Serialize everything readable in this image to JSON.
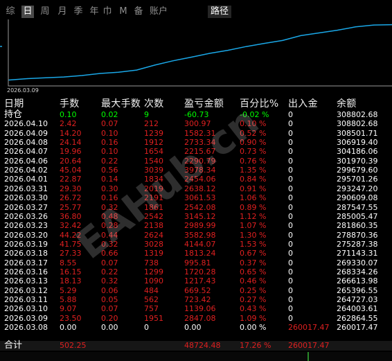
{
  "colors": {
    "background": "#000000",
    "text_red": "#e02020",
    "text_white": "#ffffff",
    "text_green": "#00ff00",
    "chart_line": "#1aa8e8",
    "active_tab": "#4a4a4a"
  },
  "tabs": [
    {
      "label": "综"
    },
    {
      "label": "日"
    },
    {
      "label": "周"
    },
    {
      "label": "月"
    },
    {
      "label": "季"
    },
    {
      "label": "年"
    },
    {
      "label": "巾"
    },
    {
      "label": "M"
    },
    {
      "label": "备"
    },
    {
      "label": "账户"
    },
    {
      "label": "路径"
    }
  ],
  "chart": {
    "start_date_label": "2026.03.09"
  },
  "chart_data": {
    "type": "line",
    "series": [
      {
        "values": [
          262864.55,
          264003.61,
          264727.03,
          265396.55,
          266613.98,
          268334.26,
          269330.07,
          271143.31,
          275287.38,
          278870.36,
          281860.35,
          285005.47,
          287547.55,
          290609.08,
          293247.2,
          295701.26,
          299679.6,
          301970.39,
          304186.06,
          306919.4,
          308501.71,
          308802.68
        ]
      }
    ]
  },
  "columns": [
    "日期",
    "手数",
    "最大手数",
    "次数",
    "盈亏金额",
    "百分比%",
    "出入金",
    "余额"
  ],
  "rows": [
    {
      "date": "持仓",
      "lots": "0.10",
      "max_lots": "0.02",
      "count": "9",
      "pnl": "-60.73",
      "pct": "-0.02 %",
      "io": "0",
      "balance": "308802.68",
      "style": "hold"
    },
    {
      "date": "2026.04.10",
      "lots": "2.42",
      "max_lots": "0.07",
      "count": "212",
      "pnl": "300.97",
      "pct": "0.10 %",
      "io": "0",
      "balance": "308802.68",
      "style": "red"
    },
    {
      "date": "2026.04.09",
      "lots": "14.20",
      "max_lots": "0.10",
      "count": "1239",
      "pnl": "1582.31",
      "pct": "0.52 %",
      "io": "0",
      "balance": "308501.71",
      "style": "red"
    },
    {
      "date": "2026.04.08",
      "lots": "24.14",
      "max_lots": "0.16",
      "count": "1912",
      "pnl": "2733.34",
      "pct": "0.90 %",
      "io": "0",
      "balance": "306919.40",
      "style": "red"
    },
    {
      "date": "2026.04.07",
      "lots": "19.96",
      "max_lots": "0.10",
      "count": "1654",
      "pnl": "2215.67",
      "pct": "0.73 %",
      "io": "0",
      "balance": "304186.06",
      "style": "red"
    },
    {
      "date": "2026.04.06",
      "lots": "20.64",
      "max_lots": "0.22",
      "count": "1540",
      "pnl": "2290.79",
      "pct": "0.76 %",
      "io": "0",
      "balance": "301970.39",
      "style": "red"
    },
    {
      "date": "2026.04.02",
      "lots": "45.04",
      "max_lots": "0.56",
      "count": "3039",
      "pnl": "3978.34",
      "pct": "1.35 %",
      "io": "0",
      "balance": "299679.60",
      "style": "red"
    },
    {
      "date": "2026.04.01",
      "lots": "22.87",
      "max_lots": "0.14",
      "count": "1834",
      "pnl": "2454.06",
      "pct": "0.84 %",
      "io": "0",
      "balance": "295701.26",
      "style": "red"
    },
    {
      "date": "2026.03.31",
      "lots": "29.30",
      "max_lots": "0.30",
      "count": "2019",
      "pnl": "2638.12",
      "pct": "0.91 %",
      "io": "0",
      "balance": "293247.20",
      "style": "red"
    },
    {
      "date": "2026.03.30",
      "lots": "26.72",
      "max_lots": "0.16",
      "count": "2191",
      "pnl": "3061.53",
      "pct": "1.06 %",
      "io": "0",
      "balance": "290609.08",
      "style": "red"
    },
    {
      "date": "2026.03.27",
      "lots": "25.77",
      "max_lots": "0.32",
      "count": "1861",
      "pnl": "2542.08",
      "pct": "0.89 %",
      "io": "0",
      "balance": "287547.55",
      "style": "red"
    },
    {
      "date": "2026.03.26",
      "lots": "36.80",
      "max_lots": "0.48",
      "count": "2542",
      "pnl": "3145.12",
      "pct": "1.12 %",
      "io": "0",
      "balance": "285005.47",
      "style": "red"
    },
    {
      "date": "2026.03.23",
      "lots": "32.42",
      "max_lots": "0.28",
      "count": "2138",
      "pnl": "2989.99",
      "pct": "1.07 %",
      "io": "0",
      "balance": "281860.35",
      "style": "red"
    },
    {
      "date": "2026.03.20",
      "lots": "44.22",
      "max_lots": "0.44",
      "count": "2624",
      "pnl": "3582.98",
      "pct": "1.30 %",
      "io": "0",
      "balance": "278870.36",
      "style": "red"
    },
    {
      "date": "2026.03.19",
      "lots": "41.75",
      "max_lots": "0.32",
      "count": "3028",
      "pnl": "4144.07",
      "pct": "1.53 %",
      "io": "0",
      "balance": "275287.38",
      "style": "red"
    },
    {
      "date": "2026.03.18",
      "lots": "27.33",
      "max_lots": "0.66",
      "count": "1319",
      "pnl": "1813.24",
      "pct": "0.67 %",
      "io": "0",
      "balance": "271143.31",
      "style": "red"
    },
    {
      "date": "2026.03.17",
      "lots": "8.55",
      "max_lots": "0.07",
      "count": "738",
      "pnl": "995.81",
      "pct": "0.37 %",
      "io": "0",
      "balance": "269330.07",
      "style": "red"
    },
    {
      "date": "2026.03.16",
      "lots": "16.15",
      "max_lots": "0.22",
      "count": "1299",
      "pnl": "1720.28",
      "pct": "0.65 %",
      "io": "0",
      "balance": "268334.26",
      "style": "red"
    },
    {
      "date": "2026.03.13",
      "lots": "18.13",
      "max_lots": "0.32",
      "count": "1090",
      "pnl": "1217.43",
      "pct": "0.46 %",
      "io": "0",
      "balance": "266613.98",
      "style": "red"
    },
    {
      "date": "2026.03.12",
      "lots": "5.29",
      "max_lots": "0.06",
      "count": "484",
      "pnl": "669.52",
      "pct": "0.25 %",
      "io": "0",
      "balance": "265396.55",
      "style": "red"
    },
    {
      "date": "2026.03.11",
      "lots": "5.88",
      "max_lots": "0.05",
      "count": "562",
      "pnl": "723.42",
      "pct": "0.27 %",
      "io": "0",
      "balance": "264727.03",
      "style": "red"
    },
    {
      "date": "2026.03.10",
      "lots": "9.07",
      "max_lots": "0.07",
      "count": "757",
      "pnl": "1139.06",
      "pct": "0.43 %",
      "io": "0",
      "balance": "264003.61",
      "style": "red"
    },
    {
      "date": "2026.03.09",
      "lots": "23.50",
      "max_lots": "0.20",
      "count": "1951",
      "pnl": "2847.08",
      "pct": "1.09 %",
      "io": "0",
      "balance": "262864.55",
      "style": "red"
    },
    {
      "date": "2026.03.08",
      "lots": "0.00",
      "max_lots": "0.00",
      "count": "0",
      "pnl": "0.00",
      "pct": "0.00 %",
      "io": "260017.47",
      "balance": "260017.47",
      "style": "deposit"
    }
  ],
  "total": {
    "label": "合计",
    "lots": "502.25",
    "pnl": "48724.48",
    "pct": "17.26 %",
    "io": "260017.47"
  },
  "watermark": "EAHub.cn"
}
